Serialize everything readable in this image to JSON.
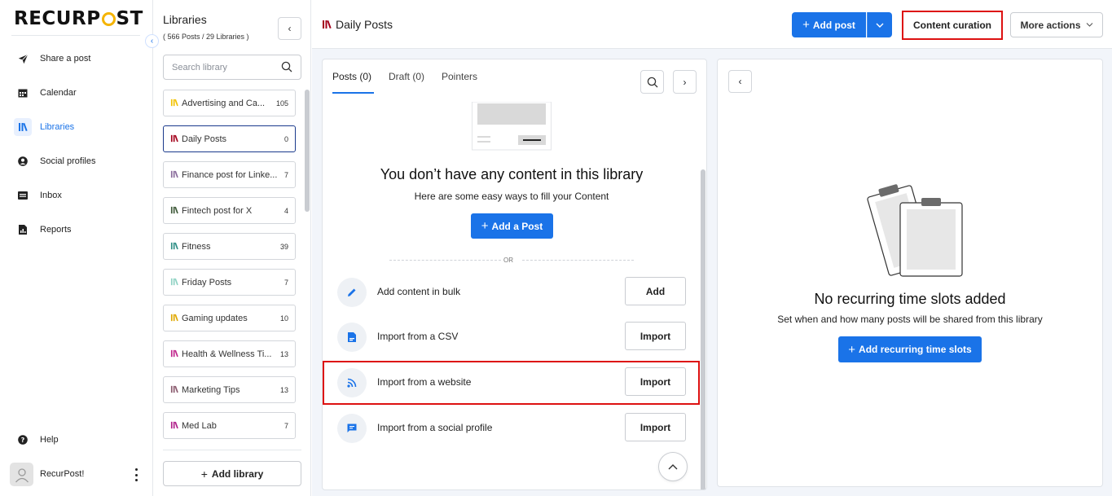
{
  "brand": {
    "logo_text_pre": "RECURP",
    "logo_text_post": "ST",
    "accent": "#1a73e8",
    "highlight": "#dd1111"
  },
  "nav": {
    "items": [
      {
        "label": "Share a post",
        "icon": "paper-plane-icon"
      },
      {
        "label": "Calendar",
        "icon": "calendar-icon"
      },
      {
        "label": "Libraries",
        "icon": "library-icon",
        "active": true
      },
      {
        "label": "Social profiles",
        "icon": "user-circle-icon"
      },
      {
        "label": "Inbox",
        "icon": "inbox-icon"
      },
      {
        "label": "Reports",
        "icon": "report-icon"
      }
    ],
    "help_label": "Help",
    "user_name": "RecurPost!"
  },
  "libraries": {
    "title": "Libraries",
    "subtitle": "( 566 Posts / 29 Libraries )",
    "search_placeholder": "Search library",
    "items": [
      {
        "name": "Advertising and Ca...",
        "count": "105",
        "color": "#f2c200"
      },
      {
        "name": "Daily Posts",
        "count": "0",
        "color": "#a3001b",
        "active": true
      },
      {
        "name": "Finance post for Linke...",
        "count": "7",
        "color": "#8a6c9c"
      },
      {
        "name": "Fintech post for X",
        "count": "4",
        "color": "#3f5a3a"
      },
      {
        "name": "Fitness",
        "count": "39",
        "color": "#2f8f86"
      },
      {
        "name": "Friday Posts",
        "count": "7",
        "color": "#8fd2c4"
      },
      {
        "name": "Gaming updates",
        "count": "10",
        "color": "#e0a800"
      },
      {
        "name": "Health & Wellness Ti...",
        "count": "13",
        "color": "#c0268c"
      },
      {
        "name": "Marketing Tips",
        "count": "13",
        "color": "#8a5a6e"
      },
      {
        "name": "Med Lab",
        "count": "7",
        "color": "#b0208a"
      }
    ],
    "add_label": "Add library"
  },
  "header": {
    "title": "Daily Posts",
    "add_post": "Add post",
    "content_curation": "Content curation",
    "more_actions": "More actions"
  },
  "posts": {
    "tabs": [
      "Posts (0)",
      "Draft (0)",
      "Pointers"
    ],
    "empty_title": "You don’t have any content in this library",
    "empty_sub": "Here are some easy ways to fill your Content",
    "add_a_post": "Add a Post",
    "or": "OR",
    "options": [
      {
        "label": "Add content in bulk",
        "button": "Add",
        "icon": "pencil-icon"
      },
      {
        "label": "Import from a CSV",
        "button": "Import",
        "icon": "csv-file-icon"
      },
      {
        "label": "Import from a website",
        "button": "Import",
        "icon": "rss-icon"
      },
      {
        "label": "Import from a social profile",
        "button": "Import",
        "icon": "chat-bubble-icon"
      }
    ]
  },
  "slots": {
    "title": "No recurring time slots added",
    "sub": "Set when and how many posts will be shared from this library",
    "button": "Add recurring time slots"
  }
}
